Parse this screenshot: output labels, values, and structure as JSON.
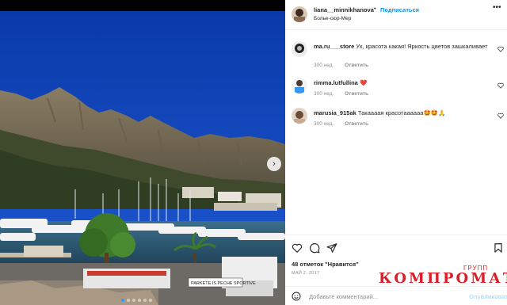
{
  "colors": {
    "sky": "#0d3fb8",
    "link": "#0095f6",
    "watermark": "#d9202a",
    "heart": "#ed4956"
  },
  "post": {
    "carousel": {
      "dots": 6,
      "active_index": 0
    }
  },
  "header": {
    "username": "liana__minnikhanova",
    "separator": "•",
    "follow_label": "Подписаться",
    "location": "Болье-сюр-Мер",
    "more_icon": "more-horizontal-icon"
  },
  "comments": [
    {
      "username": "ma.ru___store",
      "text": "Ух, красота какая! Яркость цветов зашкаливает",
      "time": "300 нед.",
      "reply": "Ответить"
    },
    {
      "username": "rimma.lutfullina",
      "text": "",
      "emoji": "❤️",
      "time": "300 нед.",
      "reply": "Ответить"
    },
    {
      "username": "marusia_915ak",
      "text": "Такаааая красотаааааа",
      "emoji": "🤩🤩🙏",
      "time": "300 нед.",
      "reply": "Ответить"
    }
  ],
  "actions": {
    "like_icon": "heart-icon",
    "comment_icon": "comment-icon",
    "share_icon": "share-icon",
    "save_icon": "bookmark-icon"
  },
  "likes": "48 отметок \"Нравится\"",
  "date": "МАЙ 2, 2017",
  "add_comment": {
    "placeholder": "Добавьте комментарий...",
    "post_label": "Опубликовать"
  },
  "watermark": {
    "text": "КОМПРОМАТ",
    "sup": "ГРУПП"
  }
}
